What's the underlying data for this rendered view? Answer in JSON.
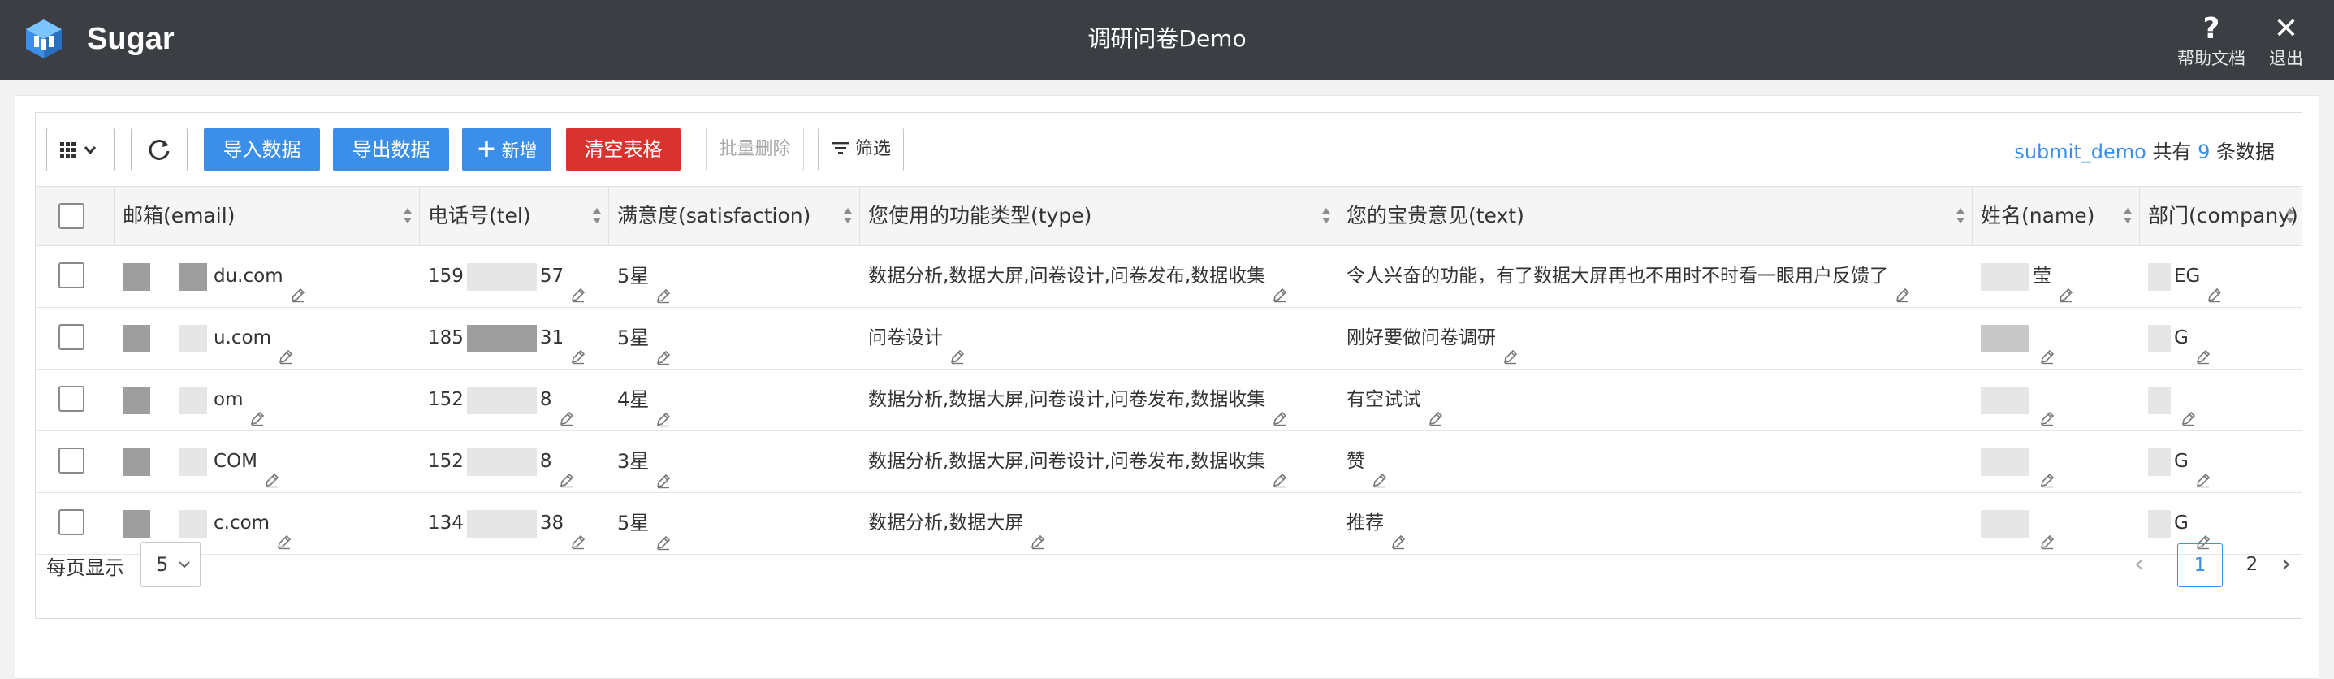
{
  "app": {
    "brand": "Sugar",
    "title": "调研问卷Demo",
    "help_label": "帮助文档",
    "help_glyph": "?",
    "exit_label": "退出",
    "exit_glyph": "✕",
    "colors": {
      "header": "#3b3f44",
      "accent": "#3b8fe8",
      "danger": "#d9332f"
    }
  },
  "toolbar": {
    "grid_icon": "grid-icon",
    "refresh_icon": "refresh-icon",
    "import_label": "导入数据",
    "export_label": "导出数据",
    "add_label": "新增",
    "add_glyph": "+",
    "clear_label": "清空表格",
    "batch_delete_label": "批量删除",
    "filter_label": "筛选"
  },
  "summary": {
    "table_name": "submit_demo",
    "prefix": "共有",
    "count": "9",
    "suffix": "条数据"
  },
  "table": {
    "columns": [
      {
        "label": "邮箱(email)"
      },
      {
        "label": "电话号(tel)"
      },
      {
        "label": "满意度(satisfaction)"
      },
      {
        "label": "您使用的功能类型(type)"
      },
      {
        "label": "您的宝贵意见(text)"
      },
      {
        "label": "姓名(name)"
      },
      {
        "label": "部门(company)"
      }
    ],
    "rows": [
      {
        "email": "du.com",
        "tel_start": "159",
        "tel_end": "57",
        "satisfaction": "5星",
        "type": "数据分析,数据大屏,问卷设计,问卷发布,数据收集",
        "text": "令人兴奋的功能，有了数据大屏再也不用时不时看一眼用户反馈了",
        "name": "莹",
        "company": "EG"
      },
      {
        "email": "u.com",
        "tel_start": "185",
        "tel_end": "31",
        "satisfaction": "5星",
        "type": "问卷设计",
        "text": "刚好要做问卷调研",
        "name": "",
        "company": "G"
      },
      {
        "email": "om",
        "tel_start": "152",
        "tel_end": "8",
        "satisfaction": "4星",
        "type": "数据分析,数据大屏,问卷设计,问卷发布,数据收集",
        "text": "有空试试",
        "name": "",
        "company": ""
      },
      {
        "email": "COM",
        "tel_start": "152",
        "tel_end": "8",
        "satisfaction": "3星",
        "type": "数据分析,数据大屏,问卷设计,问卷发布,数据收集",
        "text": "赞",
        "name": "",
        "company": "G"
      },
      {
        "email": "c.com",
        "tel_start": "134",
        "tel_end": "38",
        "satisfaction": "5星",
        "type": "数据分析,数据大屏",
        "text": "推荐",
        "name": "",
        "company": "G"
      }
    ]
  },
  "pagination": {
    "per_page_label": "每页显示",
    "per_page_value": "5",
    "pages": [
      "1",
      "2"
    ],
    "current_page": "1",
    "prev_glyph": "‹",
    "next_glyph": "›"
  }
}
